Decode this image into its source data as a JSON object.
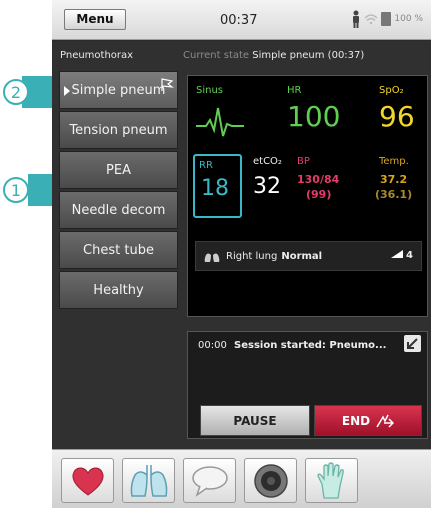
{
  "statusbar": {
    "menu_label": "Menu",
    "time": "00:37",
    "battery_text": "100 %"
  },
  "scenario": {
    "title": "Pneumothorax",
    "current_state_prefix": "Current state",
    "current_state_value": "Simple pneum (00:37)",
    "items": [
      {
        "label": "Simple pneum",
        "active": true
      },
      {
        "label": "Tension pneum",
        "active": false
      },
      {
        "label": "PEA",
        "active": false
      },
      {
        "label": "Needle decom",
        "active": false
      },
      {
        "label": "Chest tube",
        "active": false
      },
      {
        "label": "Healthy",
        "active": false
      }
    ]
  },
  "monitor": {
    "rhythm_label": "Sinus",
    "hr_label": "HR",
    "hr_value": "100",
    "spo2_label": "SpO₂",
    "spo2_value": "96",
    "rr_label": "RR",
    "rr_value": "18",
    "etco2_label": "etCO₂",
    "etco2_value": "32",
    "bp_label": "BP",
    "bp_value": "130/84",
    "bp_mean": "(99)",
    "temp_label": "Temp.",
    "temp_value": "37.2",
    "temp_secondary": "(36.1)",
    "lung_label": "Right lung",
    "lung_value": "Normal",
    "lung_level": "4",
    "colors": {
      "hr": "#5fcf52",
      "spo2": "#f2d62c",
      "rr": "#3ab8c8",
      "bp": "#e23d6a",
      "temp": "#d9a520"
    }
  },
  "log": {
    "time": "00:00",
    "message": "Session started: Pneumo...",
    "pause_label": "PAUSE",
    "end_label": "END"
  },
  "tabs": [
    "heart-icon",
    "lungs-icon",
    "speech-bubble-icon",
    "speaker-icon",
    "glove-icon"
  ],
  "callouts": [
    {
      "number": "2"
    },
    {
      "number": "1"
    }
  ],
  "accent_color": "#3ab0b6"
}
